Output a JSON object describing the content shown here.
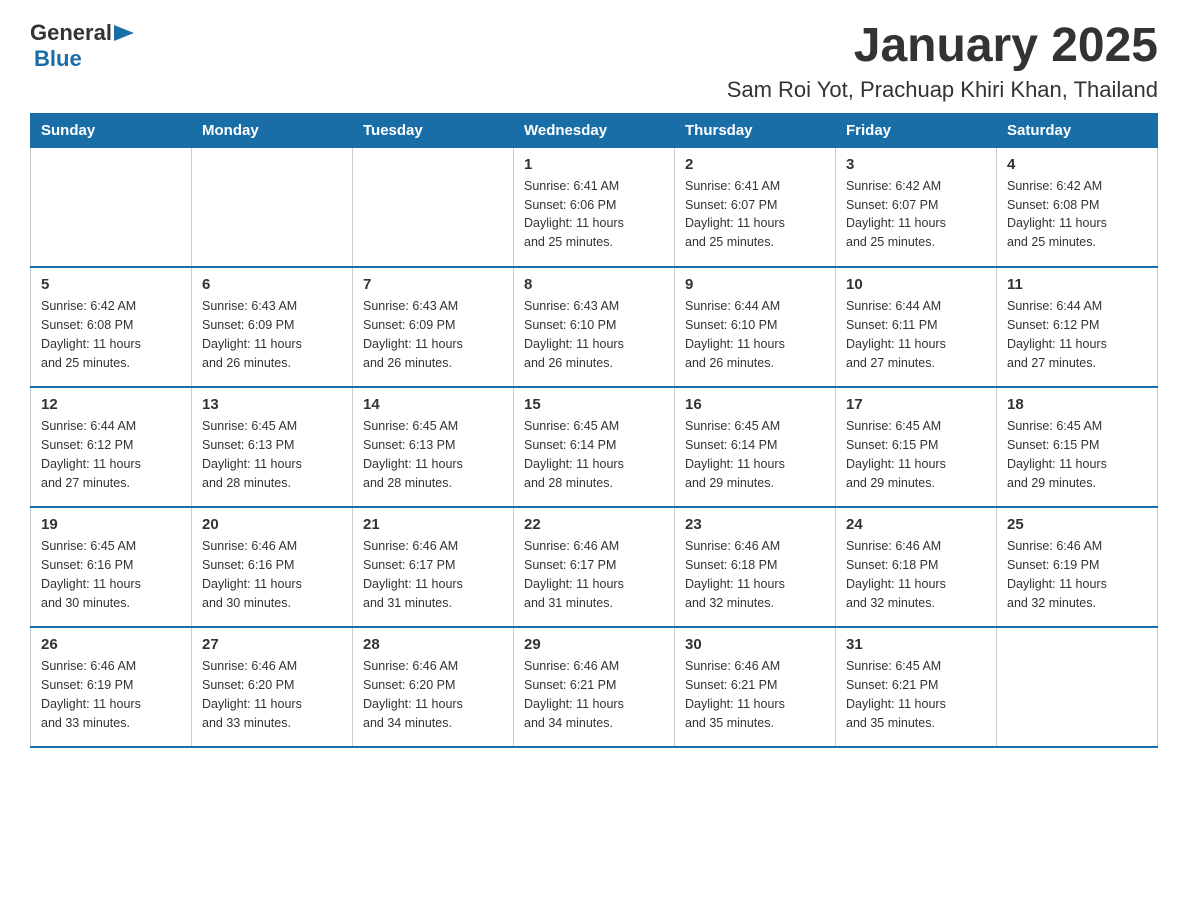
{
  "header": {
    "logo_general": "General",
    "logo_blue": "Blue",
    "title": "January 2025",
    "subtitle": "Sam Roi Yot, Prachuap Khiri Khan, Thailand"
  },
  "calendar": {
    "days_of_week": [
      "Sunday",
      "Monday",
      "Tuesday",
      "Wednesday",
      "Thursday",
      "Friday",
      "Saturday"
    ],
    "weeks": [
      [
        {
          "day": "",
          "info": ""
        },
        {
          "day": "",
          "info": ""
        },
        {
          "day": "",
          "info": ""
        },
        {
          "day": "1",
          "info": "Sunrise: 6:41 AM\nSunset: 6:06 PM\nDaylight: 11 hours\nand 25 minutes."
        },
        {
          "day": "2",
          "info": "Sunrise: 6:41 AM\nSunset: 6:07 PM\nDaylight: 11 hours\nand 25 minutes."
        },
        {
          "day": "3",
          "info": "Sunrise: 6:42 AM\nSunset: 6:07 PM\nDaylight: 11 hours\nand 25 minutes."
        },
        {
          "day": "4",
          "info": "Sunrise: 6:42 AM\nSunset: 6:08 PM\nDaylight: 11 hours\nand 25 minutes."
        }
      ],
      [
        {
          "day": "5",
          "info": "Sunrise: 6:42 AM\nSunset: 6:08 PM\nDaylight: 11 hours\nand 25 minutes."
        },
        {
          "day": "6",
          "info": "Sunrise: 6:43 AM\nSunset: 6:09 PM\nDaylight: 11 hours\nand 26 minutes."
        },
        {
          "day": "7",
          "info": "Sunrise: 6:43 AM\nSunset: 6:09 PM\nDaylight: 11 hours\nand 26 minutes."
        },
        {
          "day": "8",
          "info": "Sunrise: 6:43 AM\nSunset: 6:10 PM\nDaylight: 11 hours\nand 26 minutes."
        },
        {
          "day": "9",
          "info": "Sunrise: 6:44 AM\nSunset: 6:10 PM\nDaylight: 11 hours\nand 26 minutes."
        },
        {
          "day": "10",
          "info": "Sunrise: 6:44 AM\nSunset: 6:11 PM\nDaylight: 11 hours\nand 27 minutes."
        },
        {
          "day": "11",
          "info": "Sunrise: 6:44 AM\nSunset: 6:12 PM\nDaylight: 11 hours\nand 27 minutes."
        }
      ],
      [
        {
          "day": "12",
          "info": "Sunrise: 6:44 AM\nSunset: 6:12 PM\nDaylight: 11 hours\nand 27 minutes."
        },
        {
          "day": "13",
          "info": "Sunrise: 6:45 AM\nSunset: 6:13 PM\nDaylight: 11 hours\nand 28 minutes."
        },
        {
          "day": "14",
          "info": "Sunrise: 6:45 AM\nSunset: 6:13 PM\nDaylight: 11 hours\nand 28 minutes."
        },
        {
          "day": "15",
          "info": "Sunrise: 6:45 AM\nSunset: 6:14 PM\nDaylight: 11 hours\nand 28 minutes."
        },
        {
          "day": "16",
          "info": "Sunrise: 6:45 AM\nSunset: 6:14 PM\nDaylight: 11 hours\nand 29 minutes."
        },
        {
          "day": "17",
          "info": "Sunrise: 6:45 AM\nSunset: 6:15 PM\nDaylight: 11 hours\nand 29 minutes."
        },
        {
          "day": "18",
          "info": "Sunrise: 6:45 AM\nSunset: 6:15 PM\nDaylight: 11 hours\nand 29 minutes."
        }
      ],
      [
        {
          "day": "19",
          "info": "Sunrise: 6:45 AM\nSunset: 6:16 PM\nDaylight: 11 hours\nand 30 minutes."
        },
        {
          "day": "20",
          "info": "Sunrise: 6:46 AM\nSunset: 6:16 PM\nDaylight: 11 hours\nand 30 minutes."
        },
        {
          "day": "21",
          "info": "Sunrise: 6:46 AM\nSunset: 6:17 PM\nDaylight: 11 hours\nand 31 minutes."
        },
        {
          "day": "22",
          "info": "Sunrise: 6:46 AM\nSunset: 6:17 PM\nDaylight: 11 hours\nand 31 minutes."
        },
        {
          "day": "23",
          "info": "Sunrise: 6:46 AM\nSunset: 6:18 PM\nDaylight: 11 hours\nand 32 minutes."
        },
        {
          "day": "24",
          "info": "Sunrise: 6:46 AM\nSunset: 6:18 PM\nDaylight: 11 hours\nand 32 minutes."
        },
        {
          "day": "25",
          "info": "Sunrise: 6:46 AM\nSunset: 6:19 PM\nDaylight: 11 hours\nand 32 minutes."
        }
      ],
      [
        {
          "day": "26",
          "info": "Sunrise: 6:46 AM\nSunset: 6:19 PM\nDaylight: 11 hours\nand 33 minutes."
        },
        {
          "day": "27",
          "info": "Sunrise: 6:46 AM\nSunset: 6:20 PM\nDaylight: 11 hours\nand 33 minutes."
        },
        {
          "day": "28",
          "info": "Sunrise: 6:46 AM\nSunset: 6:20 PM\nDaylight: 11 hours\nand 34 minutes."
        },
        {
          "day": "29",
          "info": "Sunrise: 6:46 AM\nSunset: 6:21 PM\nDaylight: 11 hours\nand 34 minutes."
        },
        {
          "day": "30",
          "info": "Sunrise: 6:46 AM\nSunset: 6:21 PM\nDaylight: 11 hours\nand 35 minutes."
        },
        {
          "day": "31",
          "info": "Sunrise: 6:45 AM\nSunset: 6:21 PM\nDaylight: 11 hours\nand 35 minutes."
        },
        {
          "day": "",
          "info": ""
        }
      ]
    ]
  },
  "colors": {
    "header_bg": "#1a6ea8",
    "header_text": "#ffffff",
    "border": "#cccccc",
    "text": "#333333",
    "blue": "#1a6ea8"
  }
}
